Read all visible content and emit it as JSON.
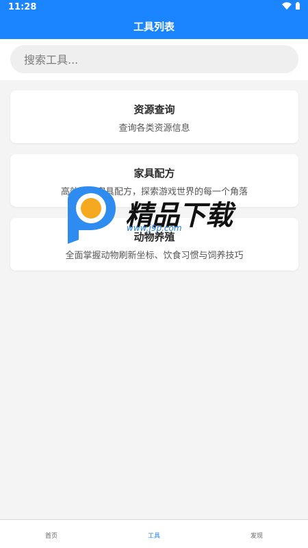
{
  "status_bar": {
    "time": "11:28"
  },
  "app_bar": {
    "title": "工具列表"
  },
  "search": {
    "placeholder": "搜索工具..."
  },
  "cards": [
    {
      "title": "资源查询",
      "description": "查询各类资源信息"
    },
    {
      "title": "家具配方",
      "description": "高效收集家具配方，探索游戏世界的每一个角落"
    },
    {
      "title": "动物养殖",
      "description": "全面掌握动物刷新坐标、饮食习惯与饲养技巧"
    }
  ],
  "watermark": {
    "text": "精品下载",
    "url": "www.j9p.com"
  },
  "bottom_nav": [
    {
      "label": "首页",
      "active": false
    },
    {
      "label": "工具",
      "active": true
    },
    {
      "label": "发现",
      "active": false
    }
  ],
  "colors": {
    "primary": "#1a85ff",
    "background": "#f4f4f4",
    "card": "#ffffff"
  }
}
